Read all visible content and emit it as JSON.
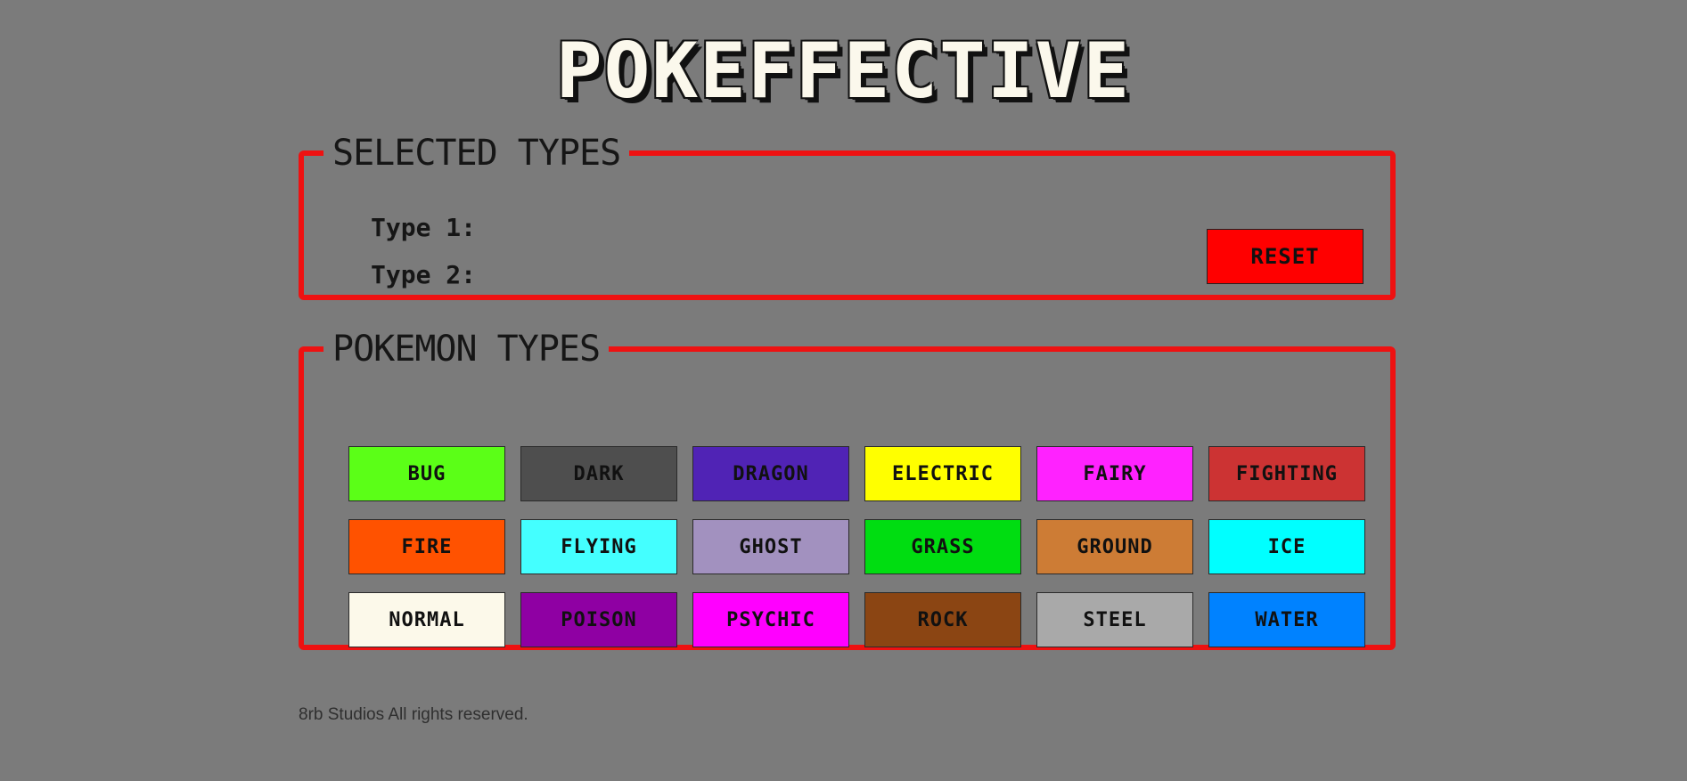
{
  "header": {
    "title": "POKEFFECTIVE"
  },
  "selected_types": {
    "legend": "SELECTED TYPES",
    "type1_label": "Type 1:",
    "type2_label": "Type 2:",
    "reset_label": "RESET"
  },
  "pokemon_types": {
    "legend": "POKEMON TYPES",
    "types": [
      {
        "label": "BUG",
        "color": "#5bff17"
      },
      {
        "label": "DARK",
        "color": "#4e4e4e"
      },
      {
        "label": "DRAGON",
        "color": "#5023b5"
      },
      {
        "label": "ELECTRIC",
        "color": "#ffff00"
      },
      {
        "label": "FAIRY",
        "color": "#ff22ff"
      },
      {
        "label": "FIGHTING",
        "color": "#cc3333"
      },
      {
        "label": "FIRE",
        "color": "#ff5200"
      },
      {
        "label": "FLYING",
        "color": "#44ffff"
      },
      {
        "label": "GHOST",
        "color": "#a291bf"
      },
      {
        "label": "GRASS",
        "color": "#00dd11"
      },
      {
        "label": "GROUND",
        "color": "#cd7c35"
      },
      {
        "label": "ICE",
        "color": "#00ffff"
      },
      {
        "label": "NORMAL",
        "color": "#fcf9ea"
      },
      {
        "label": "POISON",
        "color": "#8f00a3"
      },
      {
        "label": "PSYCHIC",
        "color": "#ff00ff"
      },
      {
        "label": "ROCK",
        "color": "#8b4513"
      },
      {
        "label": "STEEL",
        "color": "#a9a9a9"
      },
      {
        "label": "WATER",
        "color": "#0082ff"
      }
    ]
  },
  "footer": {
    "text": "8rb Studios All rights reserved."
  }
}
